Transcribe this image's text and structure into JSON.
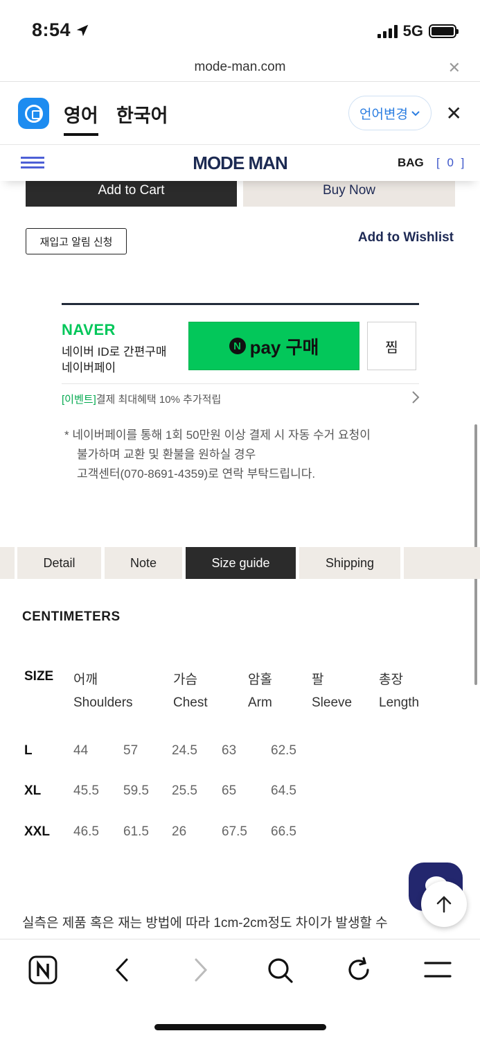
{
  "status_bar": {
    "time": "8:54",
    "network": "5G"
  },
  "url_bar": {
    "domain": "mode-man.com"
  },
  "translate_bar": {
    "active_tab": "영어",
    "other_tab": "한국어",
    "change_label": "언어변경"
  },
  "header": {
    "logo": "MODE MAN",
    "bag_label": "BAG",
    "bag_count": "[ 0 ]"
  },
  "product_actions": {
    "add_to_cart": "Add to Cart",
    "buy_now": "Buy Now",
    "restock": "재입고 알림 신청",
    "wishlist": "Add to Wishlist"
  },
  "naver_pay": {
    "brand": "NAVER",
    "desc_line1": "네이버 ID로 간편구매",
    "desc_line2": "네이버페이",
    "pay_n": "N",
    "pay_label": "pay 구매",
    "zzim": "찜",
    "event_tag": "[이벤트]",
    "event_text": "결제 최대혜택 10% 추가적립"
  },
  "notice": {
    "line1": "*  네이버페이를 통해 1회 50만원 이상 결제 시 자동 수거 요청이",
    "line2": "불가하며 교환 및 환불을 원하실 경우",
    "line3": "고객센터(070-8691-4359)로 연락 부탁드립니다."
  },
  "tabs": [
    "Detail",
    "Note",
    "Size guide",
    "Shipping"
  ],
  "active_tab": "Size guide",
  "size_guide": {
    "unit_heading": "CENTIMETERS",
    "size_header": "SIZE",
    "headers_ko": [
      "어깨",
      "가슴",
      "암홀",
      "팔",
      "총장"
    ],
    "headers_en": [
      "Shoulders",
      "Chest",
      "Arm",
      "Sleeve",
      "Length"
    ],
    "rows": [
      {
        "size": "L",
        "values": [
          "44",
          "57",
          "24.5",
          "63",
          "62.5"
        ]
      },
      {
        "size": "XL",
        "values": [
          "45.5",
          "59.5",
          "25.5",
          "65",
          "64.5"
        ]
      },
      {
        "size": "XXL",
        "values": [
          "46.5",
          "61.5",
          "26",
          "67.5",
          "66.5"
        ]
      }
    ],
    "note": "실측은 제품 혹은 재는 방법에 따라 1cm-2cm정도 차이가 발생할 수"
  },
  "icons": {
    "toolbar": [
      "naver-n-icon",
      "back-icon",
      "forward-icon",
      "search-icon",
      "refresh-icon",
      "menu-icon"
    ],
    "floating": [
      "chat-icon",
      "arrow-up-icon"
    ]
  },
  "colors": {
    "naver_green": "#03c75a",
    "brand_navy": "#1c2a52",
    "link_blue": "#2a7de1"
  }
}
